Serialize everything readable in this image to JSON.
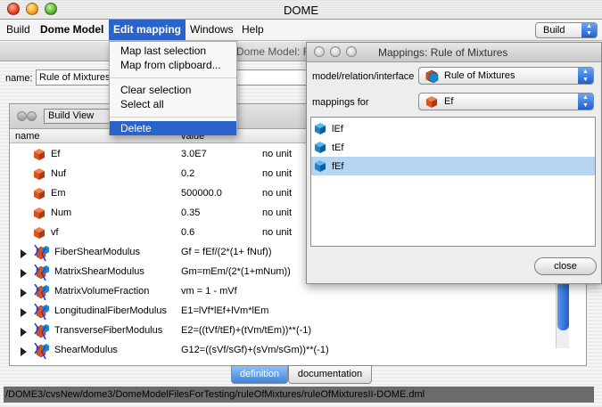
{
  "window": {
    "title": "DOME"
  },
  "menubar": {
    "items": [
      "Build",
      "Dome Model",
      "Edit mapping",
      "Windows",
      "Help"
    ],
    "build_select": "Build"
  },
  "edit_menu": {
    "items": [
      "Map last selection",
      "Map from clipboard...",
      "Clear selection",
      "Select all",
      "Delete"
    ],
    "highlighted": "Delete"
  },
  "model_window": {
    "title_fragment": "Dome Model: Rule",
    "name_label": "name:",
    "name_value": "Rule of Mixtures",
    "view_select": "Build View",
    "columns": {
      "name": "name",
      "value": "value"
    },
    "rows": [
      {
        "name": "Ef",
        "value": "3.0E7",
        "unit": "no unit",
        "kind": "param"
      },
      {
        "name": "Nuf",
        "value": "0.2",
        "unit": "no unit",
        "kind": "param"
      },
      {
        "name": "Em",
        "value": "500000.0",
        "unit": "no unit",
        "kind": "param"
      },
      {
        "name": "Num",
        "value": "0.35",
        "unit": "no unit",
        "kind": "param"
      },
      {
        "name": "vf",
        "value": "0.6",
        "unit": "no unit",
        "kind": "param"
      },
      {
        "name": "FiberShearModulus",
        "value": "Gf = fEf/(2*(1+ fNuf))",
        "unit": "",
        "kind": "relation"
      },
      {
        "name": "MatrixShearModulus",
        "value": "Gm=mEm/(2*(1+mNum))",
        "unit": "",
        "kind": "relation"
      },
      {
        "name": "MatrixVolumeFraction",
        "value": "vm = 1 - mVf",
        "unit": "",
        "kind": "relation"
      },
      {
        "name": "LongitudinalFiberModulus",
        "value": "E1=lVf*lEf+lVm*lEm",
        "unit": "",
        "kind": "relation"
      },
      {
        "name": "TransverseFiberModulus",
        "value": "E2=((tVf/tEf)+(tVm/tEm))**(-1)",
        "unit": "",
        "kind": "relation"
      },
      {
        "name": "ShearModulus",
        "value": "G12=((sVf/sGf)+(sVm/sGm))**(-1)",
        "unit": "",
        "kind": "relation"
      }
    ],
    "tabs": [
      "definition",
      "documentation"
    ],
    "active_tab": "definition",
    "status_path": "/DOME3/cvsNew/dome3/DomeModelFilesForTesting/ruleOfMixtures/ruleOfMixturesII-DOME.dml"
  },
  "mappings_window": {
    "title": "Mappings: Rule of Mixtures",
    "mri_label": "model/relation/interface",
    "mri_value": "Rule of Mixtures",
    "mappings_for_label": "mappings for",
    "mappings_for_value": "Ef",
    "list": [
      "lEf",
      "tEf",
      "fEf"
    ],
    "selected": "fEf",
    "close_label": "close"
  },
  "colors": {
    "accent": "#2a63c9",
    "param_cube": "#d9531e",
    "mapping_cube": "#1b86c8",
    "selection": "#b8d4f3"
  }
}
